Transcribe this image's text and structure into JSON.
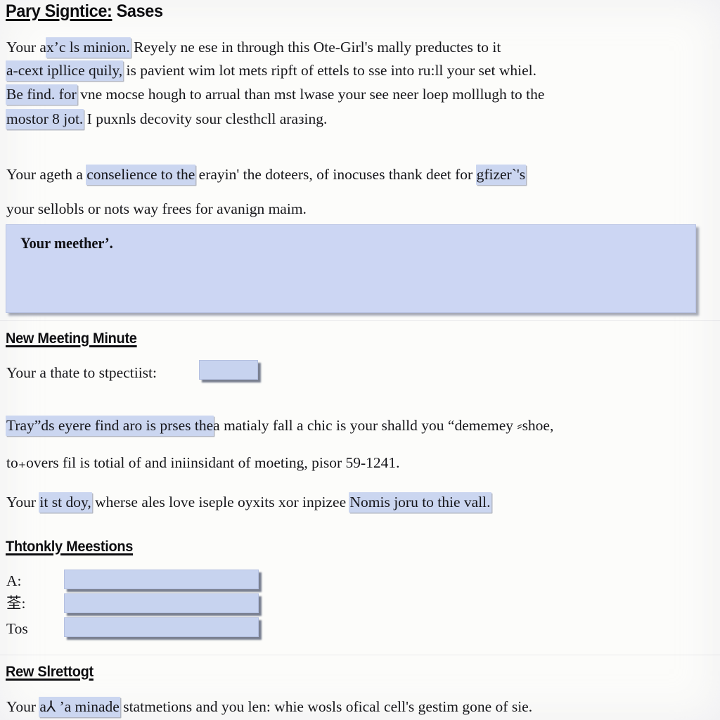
{
  "document": {
    "title": {
      "underlined": "Pary Signtice:",
      "rest": " Sases"
    },
    "paragraph1": {
      "line1_pre": "Your a",
      "line1_hl": "x’c ls minion.",
      "line1_post": " Reyely ne ese in through this Ote-Girl's mally preductes to it",
      "line2_hl": "a-cext ipllice quily,",
      "line2_post": " is pavient wim lot mets ripft of ettels to sse into ru:ll your set whiel.",
      "line3_hl": "Be find. for",
      "line3_post": " vne mocse hough to arrual than mst lwase your see neer loep molllugh to the",
      "line4_hl": "mostor 8 jot.",
      "line4_post": " I puxnls decovity sour clesthcll araзing."
    },
    "paragraph2": {
      "line1_pre": "Your ageth a ",
      "line1_hl": "conselience to the",
      "line1_mid": " erayin' the dotеers, of inocuses thank deet for ",
      "line1_hl2": "gfizer`'s",
      "line2": "your sellobls or nots way frees for avanign maim."
    },
    "callout": {
      "text": "Your meether’."
    },
    "section_meeting": {
      "heading": "New Meeting Minute",
      "label": "Your a thate to stpectiist:",
      "field_value": ""
    },
    "paragraph3": {
      "line1_hl": "Tray”ds eyere find aro is prses the",
      "line1_post": "a matialy fall a chic is your shalld you “dememey ⸗shoe,",
      "line2": "to₊overs fil is totial of and iniinsidant of moeting, pisor 59-1241.",
      "line3_pre": "Your ",
      "line3_hl": "it st doy,",
      "line3_mid": " wherse ales love iseple oyxits xor inpizee ",
      "line3_hl2": "Nomis joru to thie vall."
    },
    "section_questions": {
      "heading": "Thtonkly Meestions",
      "rows": [
        {
          "label": "A:",
          "value": ""
        },
        {
          "label": "荃:",
          "value": ""
        },
        {
          "label": "Tos",
          "value": ""
        }
      ]
    },
    "section_strettogt": {
      "heading": "Rew Slrettogt",
      "line1_pre": "Your ",
      "line1_hl": "a⅄ ’a minade",
      "line1_post": " statmetions and you len: whie wosls ofical cell's gestim gone of sie."
    },
    "colors": {
      "page_background": "#fcfcfa",
      "highlight": "#cbd6f0",
      "callout_fill": "#ccd6f3",
      "field_fill": "#c7d3ef",
      "text": "#16161a"
    }
  }
}
